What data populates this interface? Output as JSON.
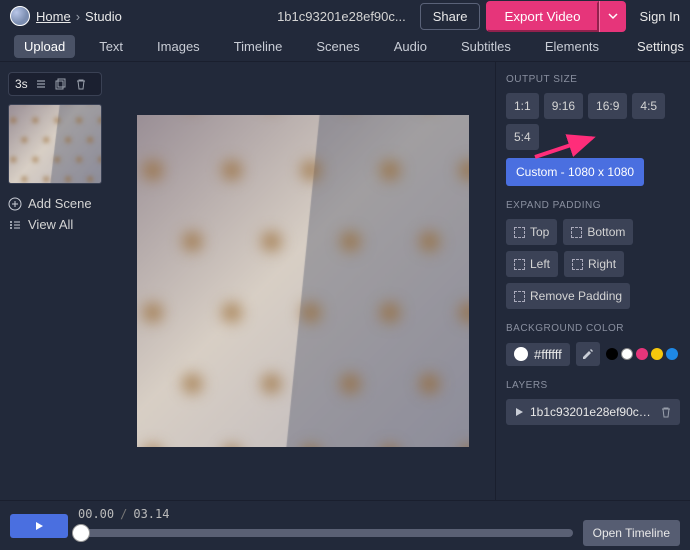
{
  "breadcrumb": {
    "home": "Home",
    "current": "Studio"
  },
  "project_name": "1b1c93201e28ef90c...",
  "top": {
    "share": "Share",
    "export": "Export Video",
    "signin": "Sign In"
  },
  "menu": {
    "items": [
      "Upload",
      "Text",
      "Images",
      "Timeline",
      "Scenes",
      "Audio",
      "Subtitles",
      "Elements"
    ],
    "active_index": 0,
    "settings": "Settings"
  },
  "left": {
    "scene_duration": "3s",
    "add_scene": "Add Scene",
    "view_all": "View All"
  },
  "right": {
    "output_size_label": "OUTPUT SIZE",
    "ratios": [
      "1:1",
      "9:16",
      "16:9",
      "4:5",
      "5:4"
    ],
    "custom": "Custom - 1080 x 1080",
    "expand_label": "EXPAND PADDING",
    "padding": {
      "top": "Top",
      "bottom": "Bottom",
      "left": "Left",
      "right": "Right",
      "remove": "Remove Padding"
    },
    "bg_label": "BACKGROUND COLOR",
    "bg_value": "#ffffff",
    "preset_colors": [
      "#000000",
      "#ffffff",
      "#e6357a",
      "#f5c60c",
      "#1e88e5"
    ],
    "layers_label": "LAYERS",
    "layer_name": "1b1c93201e28ef90cac..."
  },
  "timeline": {
    "current": "00.00",
    "total": "03.14",
    "open": "Open Timeline"
  }
}
